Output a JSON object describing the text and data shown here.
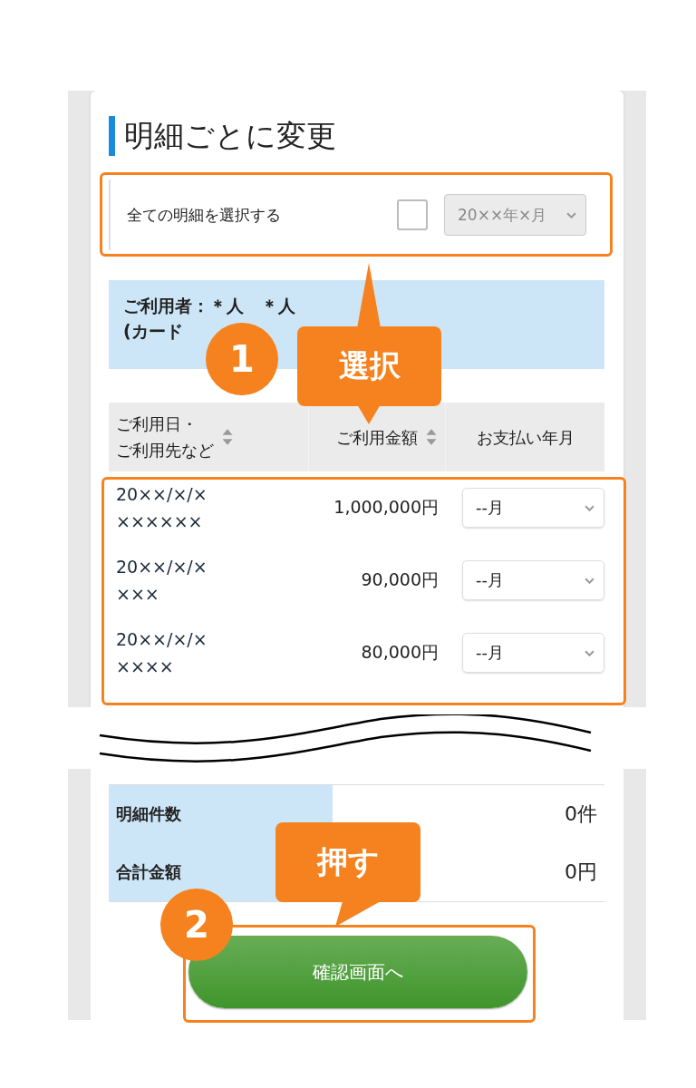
{
  "heading": "明細ごとに変更",
  "select_all": {
    "label": "全ての明細を選択する",
    "checked": false,
    "month_select": {
      "value": "20××年×月",
      "disabled": true
    }
  },
  "user_banner": {
    "lines": [
      "ご利用者：＊人　＊人",
      "(カード"
    ]
  },
  "table": {
    "columns": [
      {
        "lines": [
          "ご利用日・",
          "ご利用先など"
        ],
        "sortable": true
      },
      {
        "label": "ご利用金額",
        "sortable": true
      },
      {
        "label": "お支払い年月",
        "sortable": false
      }
    ],
    "rows": [
      {
        "date": "20××/×/×",
        "merchant": "××××××",
        "amount": "1,000,000円",
        "payment_month": "--月"
      },
      {
        "date": "20××/×/×",
        "merchant": "×××",
        "amount": "90,000円",
        "payment_month": "--月"
      },
      {
        "date": "20××/×/×",
        "merchant": "××××",
        "amount": "80,000円",
        "payment_month": "--月"
      }
    ]
  },
  "summary": [
    {
      "label": "明細件数",
      "value": "0件"
    },
    {
      "label": "合計金額",
      "value": "0円"
    }
  ],
  "confirm_button": "確認画面へ",
  "annotations": [
    {
      "number": "1",
      "label": "選択"
    },
    {
      "number": "2",
      "label": "押す"
    }
  ]
}
